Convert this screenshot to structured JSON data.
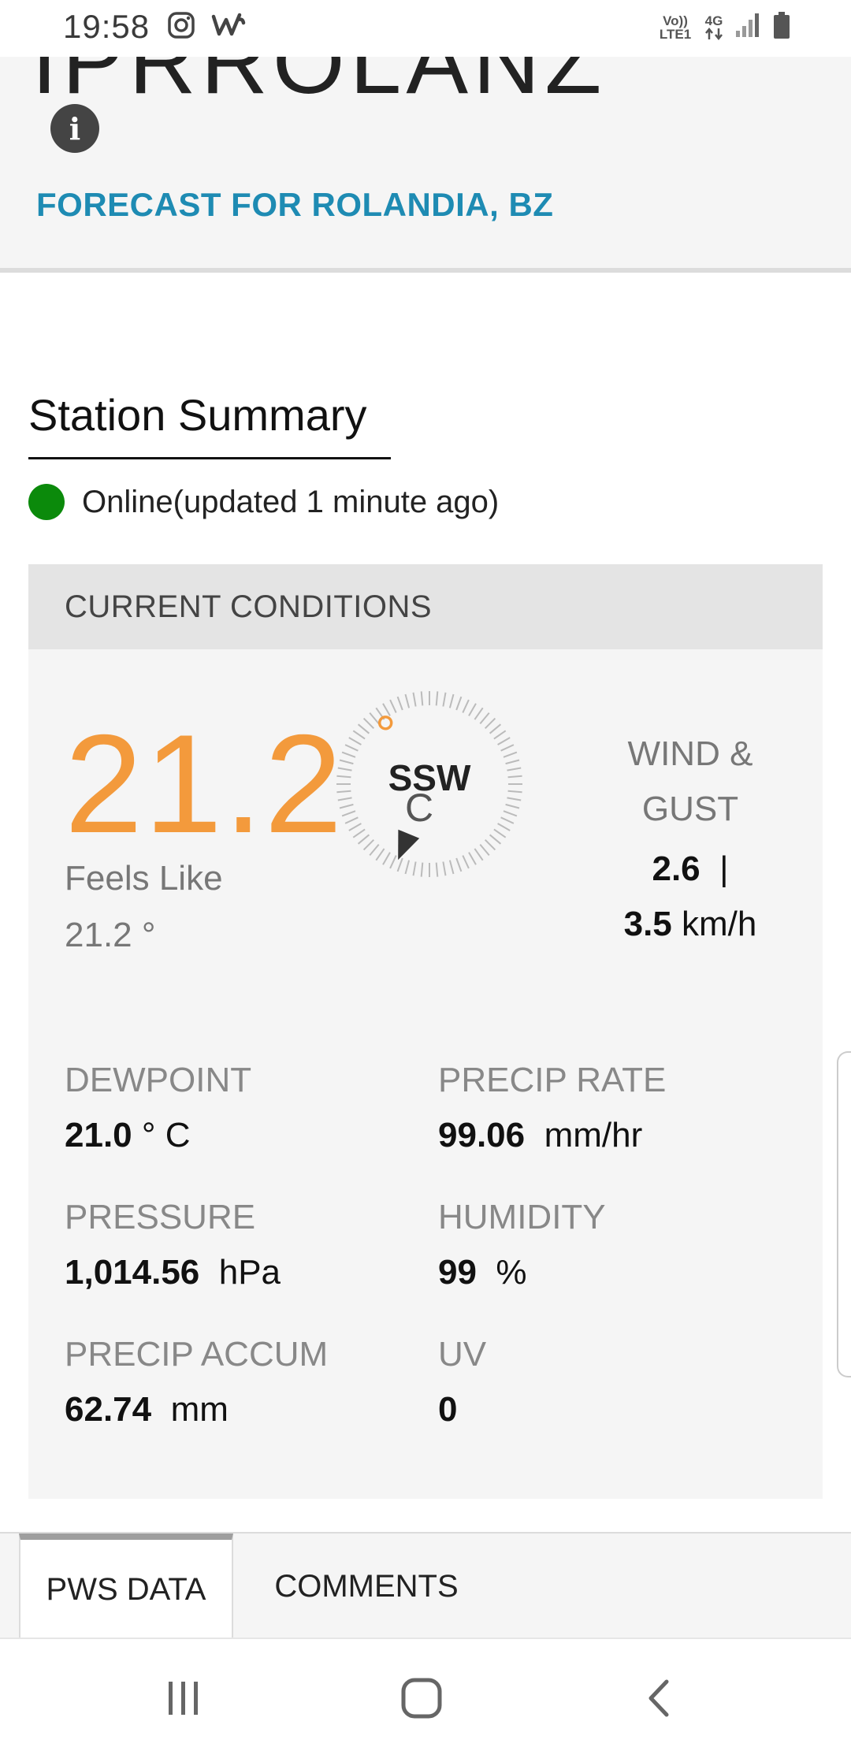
{
  "status_bar": {
    "time": "19:58",
    "network_line1": "Vo)) LTE1",
    "network_line2": "4G"
  },
  "header": {
    "station_id": "IPRROLANZ",
    "info_glyph": "i",
    "forecast_link": "FORECAST FOR ROLANDIA, BZ"
  },
  "summary": {
    "title": "Station Summary",
    "status": "Online(updated 1 minute ago)",
    "status_color": "#0b8a0b"
  },
  "conditions": {
    "header": "CURRENT CONDITIONS",
    "temperature": "21.2",
    "temp_unit_degree": "°",
    "temp_unit_letter": "C",
    "feels_like_label": "Feels Like",
    "feels_like_value": "21.2 °",
    "wind_direction": "SSW",
    "wind_label": "WIND & GUST",
    "wind_speed": "2.6",
    "wind_separator": "|",
    "gust_speed": "3.5",
    "wind_unit": "km/h",
    "dewpoint_label": "DEWPOINT",
    "dewpoint_value": "21.0",
    "dewpoint_unit": "° C",
    "precip_rate_label": "PRECIP RATE",
    "precip_rate_value": "99.06",
    "precip_rate_unit": "mm/hr",
    "pressure_label": "PRESSURE",
    "pressure_value": "1,014.56",
    "pressure_unit": "hPa",
    "humidity_label": "HUMIDITY",
    "humidity_value": "99",
    "humidity_unit": "%",
    "precip_accum_label": "PRECIP ACCUM",
    "precip_accum_value": "62.74",
    "precip_accum_unit": "mm",
    "uv_label": "UV",
    "uv_value": "0",
    "temp_color": "#f39a3c"
  },
  "tabs": [
    {
      "label": "PWS DATA",
      "active": true
    },
    {
      "label": "COMMENTS",
      "active": false
    }
  ],
  "nav": {
    "recents_icon": "recent-apps-icon",
    "home_icon": "home-icon",
    "back_icon": "back-icon"
  }
}
